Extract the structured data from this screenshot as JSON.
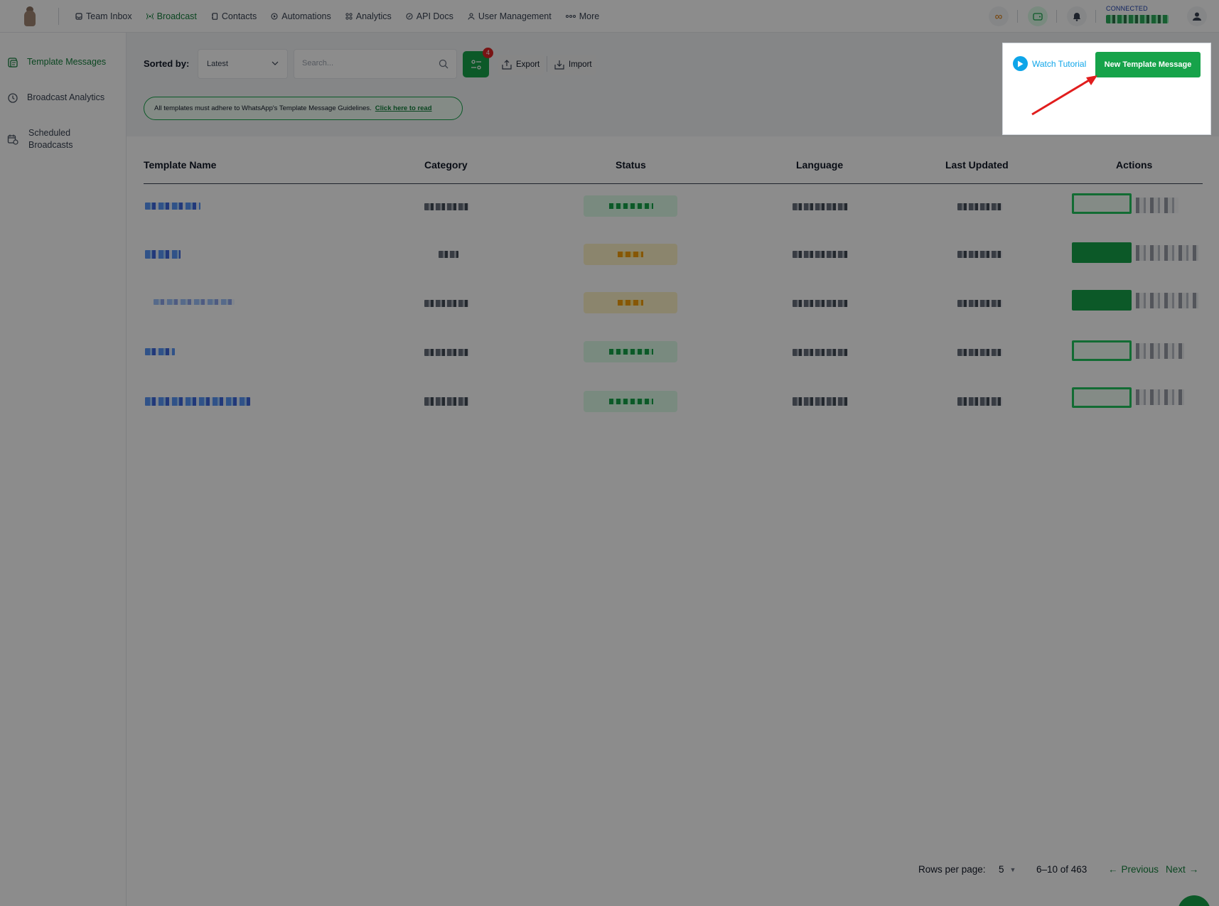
{
  "nav": {
    "items": [
      {
        "label": "Team Inbox",
        "icon": "inbox-icon"
      },
      {
        "label": "Broadcast",
        "icon": "broadcast-icon",
        "active": true
      },
      {
        "label": "Contacts",
        "icon": "contacts-icon"
      },
      {
        "label": "Automations",
        "icon": "automations-icon"
      },
      {
        "label": "Analytics",
        "icon": "analytics-icon"
      },
      {
        "label": "API Docs",
        "icon": "api-icon"
      },
      {
        "label": "User Management",
        "icon": "users-icon"
      },
      {
        "label": "More",
        "icon": "more-icon"
      }
    ],
    "connection_status": "CONNECTED"
  },
  "sidebar": {
    "items": [
      {
        "label": "Template Messages",
        "active": true
      },
      {
        "label": "Broadcast Analytics"
      },
      {
        "label": "Scheduled Broadcasts"
      }
    ]
  },
  "toolbar": {
    "sorted_by_label": "Sorted by:",
    "sort_value": "Latest",
    "search_placeholder": "Search...",
    "filter_badge": "4",
    "export_label": "Export",
    "import_label": "Import"
  },
  "guideline": {
    "text": "All templates must adhere to WhatsApp's Template Message Guidelines.",
    "link": "Click here to read"
  },
  "callout": {
    "watch_label": "Watch Tutorial",
    "new_template_label": "New Template Message"
  },
  "table": {
    "headers": [
      "Template Name",
      "Category",
      "Status",
      "Language",
      "Last Updated",
      "Actions"
    ],
    "rows": [
      {
        "status": "approved",
        "action": "outline"
      },
      {
        "status": "pending",
        "action": "solid"
      },
      {
        "status": "pending",
        "action": "solid"
      },
      {
        "status": "approved",
        "action": "outline"
      },
      {
        "status": "approved",
        "action": "outline"
      }
    ]
  },
  "pagination": {
    "rows_per_page_label": "Rows per page:",
    "rows_per_page": "5",
    "range": "6–10 of 463",
    "previous": "Previous",
    "next": "Next"
  },
  "colors": {
    "brand_green": "#16a34a",
    "link_blue": "#0ea5e9",
    "badge_red": "#dc2626",
    "arrow_red": "#e11d1d"
  }
}
